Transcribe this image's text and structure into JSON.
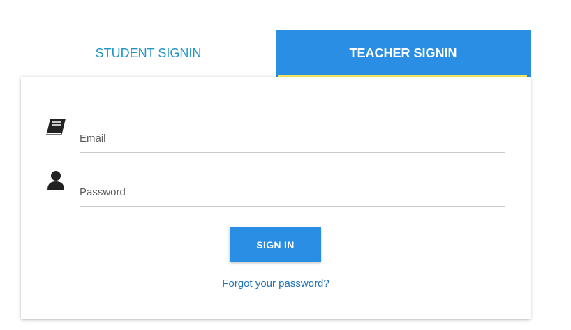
{
  "tabs": {
    "student": {
      "label": "STUDENT SIGNIN",
      "active": false
    },
    "teacher": {
      "label": "TEACHER SIGNIN",
      "active": true
    }
  },
  "form": {
    "email": {
      "placeholder": "Email",
      "value": "",
      "icon": "book-icon"
    },
    "password": {
      "placeholder": "Password",
      "value": "",
      "icon": "user-icon"
    },
    "submit_label": "SIGN IN",
    "forgot_label": "Forgot your password?"
  },
  "colors": {
    "accent": "#2a8ee4",
    "tab_indicator": "#f2e35a",
    "link": "#1e72b8",
    "inactive_tab_text": "#2196c4"
  }
}
